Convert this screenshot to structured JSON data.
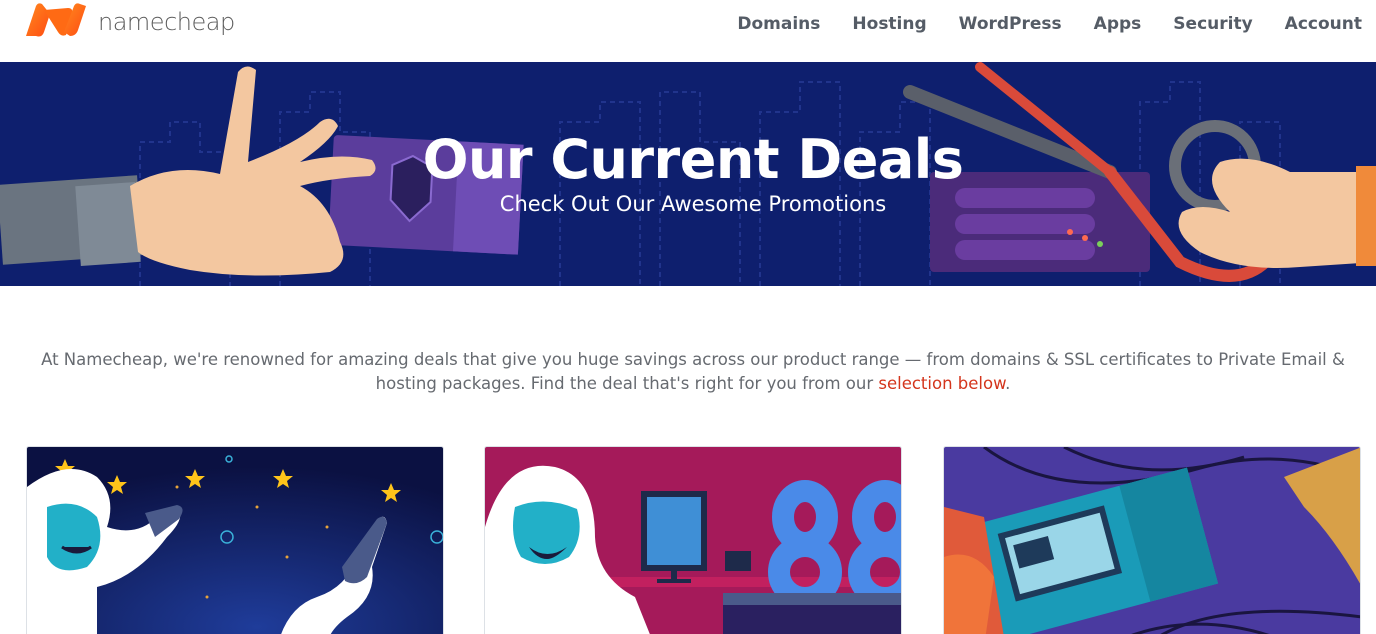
{
  "brand": {
    "name": "namecheap"
  },
  "nav": {
    "items": [
      {
        "label": "Domains"
      },
      {
        "label": "Hosting"
      },
      {
        "label": "WordPress"
      },
      {
        "label": "Apps"
      },
      {
        "label": "Security"
      },
      {
        "label": "Account"
      }
    ]
  },
  "hero": {
    "title": "Our Current Deals",
    "subtitle": "Check Out Our Awesome Promotions"
  },
  "intro": {
    "text": "At Namecheap, we're renowned for amazing deals that give you huge savings across our product range — from domains & SSL certificates to Private Email & hosting packages. Find the deal that's right for you from our ",
    "link_text": "selection below",
    "tail": "."
  },
  "cards": [
    {
      "illustration": "yeti-stars-night-illustration"
    },
    {
      "illustration": "yeti-desk-88-illustration"
    },
    {
      "illustration": "ticket-scissors-illustration"
    }
  ],
  "colors": {
    "hero_bg": "#0e1f6e",
    "accent": "#ff5a1f",
    "link": "#d4351c",
    "nav_text": "#555c66"
  }
}
